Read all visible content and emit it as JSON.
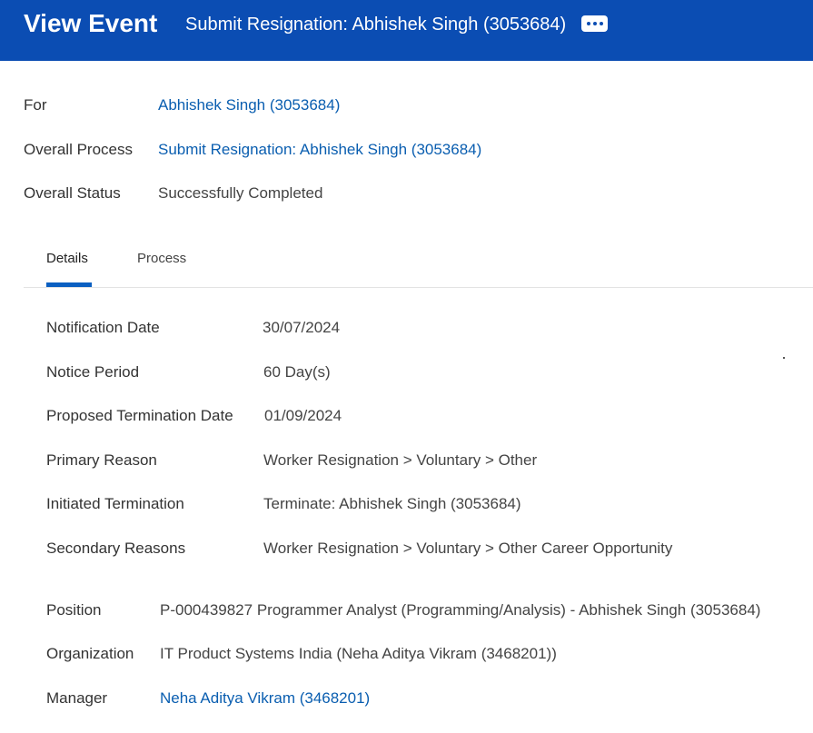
{
  "header": {
    "title": "View Event",
    "subtitle": "Submit Resignation: Abhishek Singh (3053684)",
    "more_icon": "more-horizontal-icon"
  },
  "summary": {
    "for_label": "For",
    "for_value": "Abhishek Singh (3053684)",
    "process_label": "Overall Process",
    "process_value": "Submit Resignation: Abhishek Singh (3053684)",
    "status_label": "Overall Status",
    "status_value": "Successfully Completed"
  },
  "tabs": [
    {
      "label": "Details",
      "active": true
    },
    {
      "label": "Process",
      "active": false
    }
  ],
  "details": {
    "notification_date_label": "Notification Date",
    "notification_date_value": "30/07/2024",
    "notice_period_label": "Notice Period",
    "notice_period_value": "60 Day(s)",
    "proposed_termination_label": "Proposed Termination Date",
    "proposed_termination_value": "01/09/2024",
    "primary_reason_label": "Primary Reason",
    "primary_reason_value": "Worker Resignation > Voluntary > Other",
    "initiated_termination_label": "Initiated Termination",
    "initiated_termination_value": "Terminate: Abhishek Singh (3053684)",
    "secondary_reasons_label": "Secondary Reasons",
    "secondary_reasons_value": "Worker Resignation > Voluntary > Other Career Opportunity",
    "position_label": "Position",
    "position_value": "P-000439827 Programmer Analyst (Programming/Analysis) - Abhishek Singh (3053684)",
    "organization_label": "Organization",
    "organization_value": "IT Product Systems India (Neha Aditya Vikram (3468201))",
    "manager_label": "Manager",
    "manager_value": "Neha Aditya Vikram (3468201)"
  },
  "colors": {
    "header_bg": "#0b4db3",
    "link": "#0a5eb0",
    "tab_underline": "#0b5fc1"
  }
}
